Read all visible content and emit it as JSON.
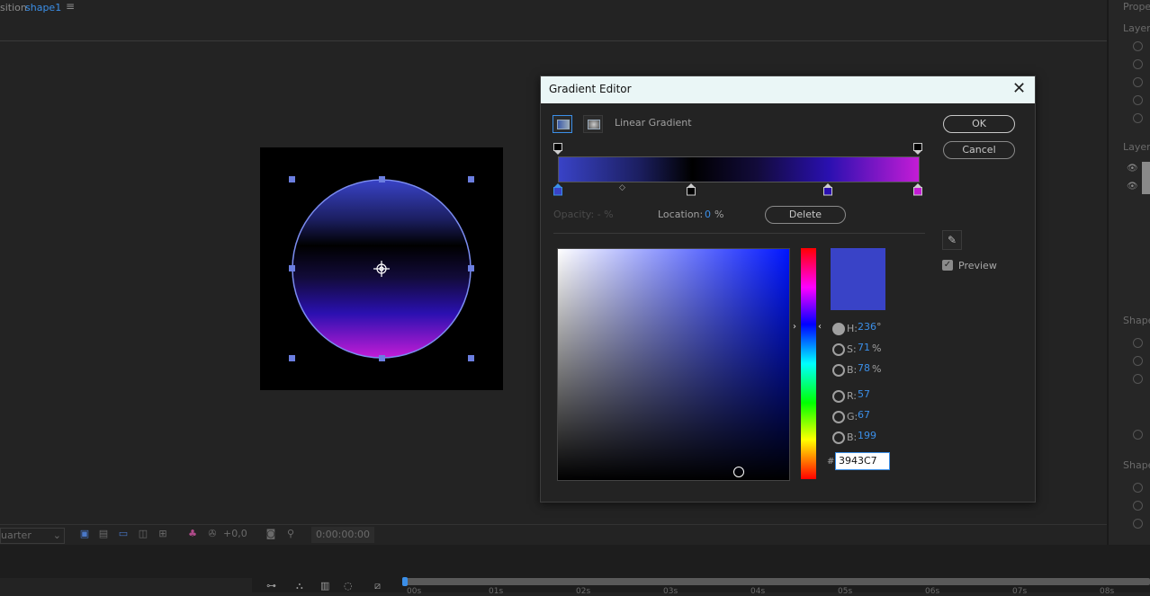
{
  "composition": {
    "title_prefix": "sition",
    "title_name": "shape1"
  },
  "right_panel": {
    "labels": [
      "Prope",
      "Layer",
      "Layer",
      "Shape",
      "Shape"
    ]
  },
  "viewer_toolbar": {
    "zoom_value": "uarter",
    "exposure": "+0,0",
    "timecode": "0:00:00:00"
  },
  "timeline": {
    "ticks": [
      "00s",
      "01s",
      "02s",
      "03s",
      "04s",
      "05s",
      "06s",
      "07s",
      "08s"
    ]
  },
  "dialog": {
    "title": "Gradient Editor",
    "close_label": "✕",
    "gradient_type_label": "Linear Gradient",
    "ok_label": "OK",
    "cancel_label": "Cancel",
    "opacity_label": "Opacity:  - %",
    "location_label": "Location:",
    "location_value": "0",
    "location_unit": "%",
    "delete_label": "Delete",
    "preview_label": "Preview",
    "preview_checked": true,
    "stops": [
      {
        "location_pct": 0,
        "color": "#3943c7",
        "selected": true
      },
      {
        "location_pct": 37,
        "color": "#000000",
        "selected": false
      },
      {
        "location_pct": 75,
        "color": "#2a10b0",
        "selected": false
      },
      {
        "location_pct": 100,
        "color": "#c41cd6",
        "selected": false
      }
    ],
    "midpoint_pct": 18,
    "color_picker": {
      "mode": "H",
      "H": {
        "label": "H:",
        "value": "236",
        "unit": "°"
      },
      "S": {
        "label": "S:",
        "value": "71",
        "unit": "%"
      },
      "B": {
        "label": "B:",
        "value": "78",
        "unit": "%"
      },
      "R": {
        "label": "R:",
        "value": "57"
      },
      "G": {
        "label": "G:",
        "value": "67"
      },
      "Bl": {
        "label": "B:",
        "value": "199"
      },
      "hash": "#",
      "hex": "3943C7",
      "swatch_color": "#3943c7"
    }
  }
}
